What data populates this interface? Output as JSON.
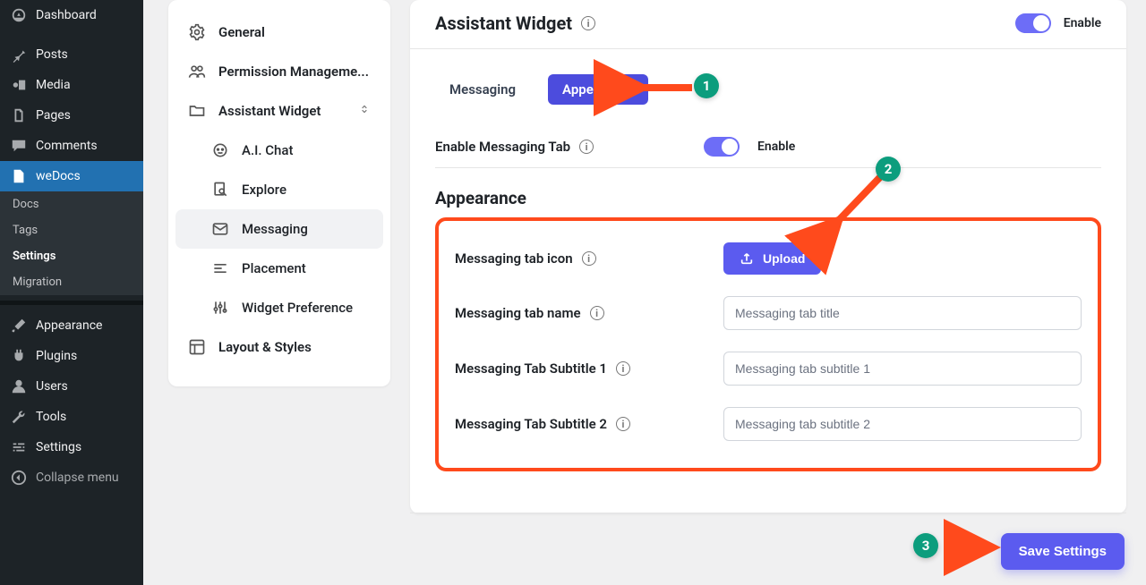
{
  "wp_sidebar": {
    "items": [
      {
        "label": "Dashboard",
        "icon": "gauge"
      },
      {
        "label": "Posts",
        "icon": "pin"
      },
      {
        "label": "Media",
        "icon": "media"
      },
      {
        "label": "Pages",
        "icon": "pages"
      },
      {
        "label": "Comments",
        "icon": "comment"
      },
      {
        "label": "weDocs",
        "icon": "doc",
        "active": true,
        "sub": [
          {
            "label": "Docs"
          },
          {
            "label": "Tags"
          },
          {
            "label": "Settings",
            "active": true
          },
          {
            "label": "Migration"
          }
        ]
      },
      {
        "label": "Appearance",
        "icon": "brush"
      },
      {
        "label": "Plugins",
        "icon": "plug"
      },
      {
        "label": "Users",
        "icon": "user"
      },
      {
        "label": "Tools",
        "icon": "wrench"
      },
      {
        "label": "Settings",
        "icon": "sliders"
      },
      {
        "label": "Collapse menu",
        "icon": "collapse"
      }
    ]
  },
  "settings_sidebar": {
    "items": [
      {
        "label": "General",
        "icon": "gear"
      },
      {
        "label": "Permission Manageme...",
        "icon": "people"
      },
      {
        "label": "Assistant Widget",
        "icon": "folder",
        "expandable": true,
        "children": [
          {
            "label": "A.I. Chat",
            "icon": "robot"
          },
          {
            "label": "Explore",
            "icon": "search-doc"
          },
          {
            "label": "Messaging",
            "icon": "mail",
            "active": true
          },
          {
            "label": "Placement",
            "icon": "lines"
          },
          {
            "label": "Widget Preference",
            "icon": "sliders-h"
          }
        ]
      },
      {
        "label": "Layout & Styles",
        "icon": "layout"
      }
    ]
  },
  "main": {
    "title": "Assistant Widget",
    "enable_label": "Enable",
    "tabs": [
      {
        "label": "Messaging"
      },
      {
        "label": "Appearance",
        "active": true
      }
    ],
    "enable_messaging": {
      "label": "Enable Messaging Tab",
      "toggle_label": "Enable"
    },
    "appearance_heading": "Appearance",
    "fields": {
      "icon": {
        "label": "Messaging tab icon",
        "button": "Upload"
      },
      "name": {
        "label": "Messaging tab name",
        "placeholder": "Messaging tab title"
      },
      "sub1": {
        "label": "Messaging Tab Subtitle 1",
        "placeholder": "Messaging tab subtitle 1"
      },
      "sub2": {
        "label": "Messaging Tab Subtitle 2",
        "placeholder": "Messaging tab subtitle 2"
      }
    }
  },
  "save_button": "Save Settings",
  "annotations": {
    "badge1": "1",
    "badge2": "2",
    "badge3": "3"
  }
}
